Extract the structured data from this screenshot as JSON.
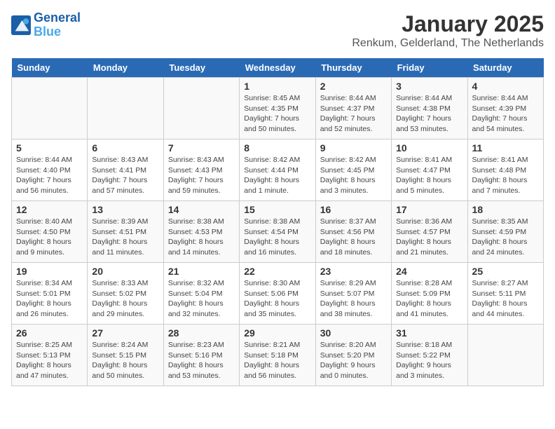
{
  "header": {
    "logo_line1": "General",
    "logo_line2": "Blue",
    "title": "January 2025",
    "subtitle": "Renkum, Gelderland, The Netherlands"
  },
  "weekdays": [
    "Sunday",
    "Monday",
    "Tuesday",
    "Wednesday",
    "Thursday",
    "Friday",
    "Saturday"
  ],
  "weeks": [
    [
      {
        "num": "",
        "info": ""
      },
      {
        "num": "",
        "info": ""
      },
      {
        "num": "",
        "info": ""
      },
      {
        "num": "1",
        "info": "Sunrise: 8:45 AM\nSunset: 4:35 PM\nDaylight: 7 hours\nand 50 minutes."
      },
      {
        "num": "2",
        "info": "Sunrise: 8:44 AM\nSunset: 4:37 PM\nDaylight: 7 hours\nand 52 minutes."
      },
      {
        "num": "3",
        "info": "Sunrise: 8:44 AM\nSunset: 4:38 PM\nDaylight: 7 hours\nand 53 minutes."
      },
      {
        "num": "4",
        "info": "Sunrise: 8:44 AM\nSunset: 4:39 PM\nDaylight: 7 hours\nand 54 minutes."
      }
    ],
    [
      {
        "num": "5",
        "info": "Sunrise: 8:44 AM\nSunset: 4:40 PM\nDaylight: 7 hours\nand 56 minutes."
      },
      {
        "num": "6",
        "info": "Sunrise: 8:43 AM\nSunset: 4:41 PM\nDaylight: 7 hours\nand 57 minutes."
      },
      {
        "num": "7",
        "info": "Sunrise: 8:43 AM\nSunset: 4:43 PM\nDaylight: 7 hours\nand 59 minutes."
      },
      {
        "num": "8",
        "info": "Sunrise: 8:42 AM\nSunset: 4:44 PM\nDaylight: 8 hours\nand 1 minute."
      },
      {
        "num": "9",
        "info": "Sunrise: 8:42 AM\nSunset: 4:45 PM\nDaylight: 8 hours\nand 3 minutes."
      },
      {
        "num": "10",
        "info": "Sunrise: 8:41 AM\nSunset: 4:47 PM\nDaylight: 8 hours\nand 5 minutes."
      },
      {
        "num": "11",
        "info": "Sunrise: 8:41 AM\nSunset: 4:48 PM\nDaylight: 8 hours\nand 7 minutes."
      }
    ],
    [
      {
        "num": "12",
        "info": "Sunrise: 8:40 AM\nSunset: 4:50 PM\nDaylight: 8 hours\nand 9 minutes."
      },
      {
        "num": "13",
        "info": "Sunrise: 8:39 AM\nSunset: 4:51 PM\nDaylight: 8 hours\nand 11 minutes."
      },
      {
        "num": "14",
        "info": "Sunrise: 8:38 AM\nSunset: 4:53 PM\nDaylight: 8 hours\nand 14 minutes."
      },
      {
        "num": "15",
        "info": "Sunrise: 8:38 AM\nSunset: 4:54 PM\nDaylight: 8 hours\nand 16 minutes."
      },
      {
        "num": "16",
        "info": "Sunrise: 8:37 AM\nSunset: 4:56 PM\nDaylight: 8 hours\nand 18 minutes."
      },
      {
        "num": "17",
        "info": "Sunrise: 8:36 AM\nSunset: 4:57 PM\nDaylight: 8 hours\nand 21 minutes."
      },
      {
        "num": "18",
        "info": "Sunrise: 8:35 AM\nSunset: 4:59 PM\nDaylight: 8 hours\nand 24 minutes."
      }
    ],
    [
      {
        "num": "19",
        "info": "Sunrise: 8:34 AM\nSunset: 5:01 PM\nDaylight: 8 hours\nand 26 minutes."
      },
      {
        "num": "20",
        "info": "Sunrise: 8:33 AM\nSunset: 5:02 PM\nDaylight: 8 hours\nand 29 minutes."
      },
      {
        "num": "21",
        "info": "Sunrise: 8:32 AM\nSunset: 5:04 PM\nDaylight: 8 hours\nand 32 minutes."
      },
      {
        "num": "22",
        "info": "Sunrise: 8:30 AM\nSunset: 5:06 PM\nDaylight: 8 hours\nand 35 minutes."
      },
      {
        "num": "23",
        "info": "Sunrise: 8:29 AM\nSunset: 5:07 PM\nDaylight: 8 hours\nand 38 minutes."
      },
      {
        "num": "24",
        "info": "Sunrise: 8:28 AM\nSunset: 5:09 PM\nDaylight: 8 hours\nand 41 minutes."
      },
      {
        "num": "25",
        "info": "Sunrise: 8:27 AM\nSunset: 5:11 PM\nDaylight: 8 hours\nand 44 minutes."
      }
    ],
    [
      {
        "num": "26",
        "info": "Sunrise: 8:25 AM\nSunset: 5:13 PM\nDaylight: 8 hours\nand 47 minutes."
      },
      {
        "num": "27",
        "info": "Sunrise: 8:24 AM\nSunset: 5:15 PM\nDaylight: 8 hours\nand 50 minutes."
      },
      {
        "num": "28",
        "info": "Sunrise: 8:23 AM\nSunset: 5:16 PM\nDaylight: 8 hours\nand 53 minutes."
      },
      {
        "num": "29",
        "info": "Sunrise: 8:21 AM\nSunset: 5:18 PM\nDaylight: 8 hours\nand 56 minutes."
      },
      {
        "num": "30",
        "info": "Sunrise: 8:20 AM\nSunset: 5:20 PM\nDaylight: 9 hours\nand 0 minutes."
      },
      {
        "num": "31",
        "info": "Sunrise: 8:18 AM\nSunset: 5:22 PM\nDaylight: 9 hours\nand 3 minutes."
      },
      {
        "num": "",
        "info": ""
      }
    ]
  ]
}
